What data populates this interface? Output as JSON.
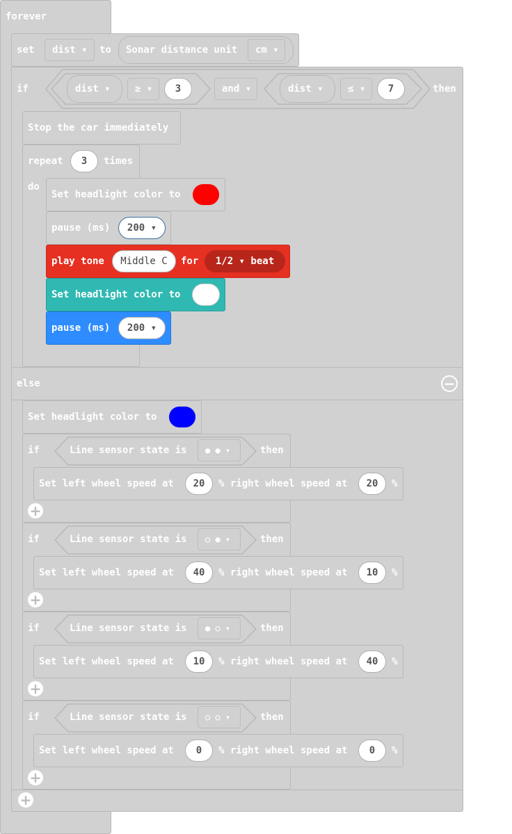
{
  "forever": "forever",
  "set": {
    "kw": "set",
    "var": "dist ▾",
    "to": "to",
    "sonar_label": "Sonar distance unit",
    "unit": "cm ▾"
  },
  "if1": {
    "kw": "if",
    "left_var": "dist ▾",
    "left_op": "≥ ▾",
    "left_val": "3",
    "and": "and ▾",
    "right_var": "dist ▾",
    "right_op": "≤ ▾",
    "right_val": "7",
    "then": "then"
  },
  "stop": "Stop the car immediately",
  "repeat": {
    "kw": "repeat",
    "count": "3",
    "times": "times",
    "do": "do"
  },
  "headlight1": {
    "label": "Set headlight color to",
    "color": "#ff0000"
  },
  "pause1": {
    "label": "pause (ms)",
    "value": "200 ▾"
  },
  "tone": {
    "label": "play tone",
    "note": "Middle C",
    "for": "for",
    "beat": "1/2 ▾ beat"
  },
  "headlight2": {
    "label": "Set headlight color to",
    "color": "#ffffff"
  },
  "pause2": {
    "label": "pause (ms)",
    "value": "200 ▾"
  },
  "else": "else",
  "headlight3": {
    "label": "Set headlight color to",
    "color": "#0000ff"
  },
  "line_ifs": [
    {
      "if": "if",
      "label": "Line sensor state is",
      "state": "● ● ▾",
      "then": "then",
      "wheel_left_label": "Set left wheel speed at",
      "left": "20",
      "mid": "% right wheel speed at",
      "right": "20",
      "pct": "%"
    },
    {
      "if": "if",
      "label": "Line sensor state is",
      "state": "○ ● ▾",
      "then": "then",
      "wheel_left_label": "Set left wheel speed at",
      "left": "40",
      "mid": "% right wheel speed at",
      "right": "10",
      "pct": "%"
    },
    {
      "if": "if",
      "label": "Line sensor state is",
      "state": "● ○ ▾",
      "then": "then",
      "wheel_left_label": "Set left wheel speed at",
      "left": "10",
      "mid": "% right wheel speed at",
      "right": "40",
      "pct": "%"
    },
    {
      "if": "if",
      "label": "Line sensor state is",
      "state": "○ ○ ▾",
      "then": "then",
      "wheel_left_label": "Set left wheel speed at",
      "left": "0",
      "mid": "% right wheel speed at",
      "right": "0",
      "pct": "%"
    }
  ],
  "colors": {
    "block_gray": "#d1d1d1",
    "tone_red": "#e63022",
    "teal": "#30b9b2",
    "blue": "#2e8cff"
  }
}
